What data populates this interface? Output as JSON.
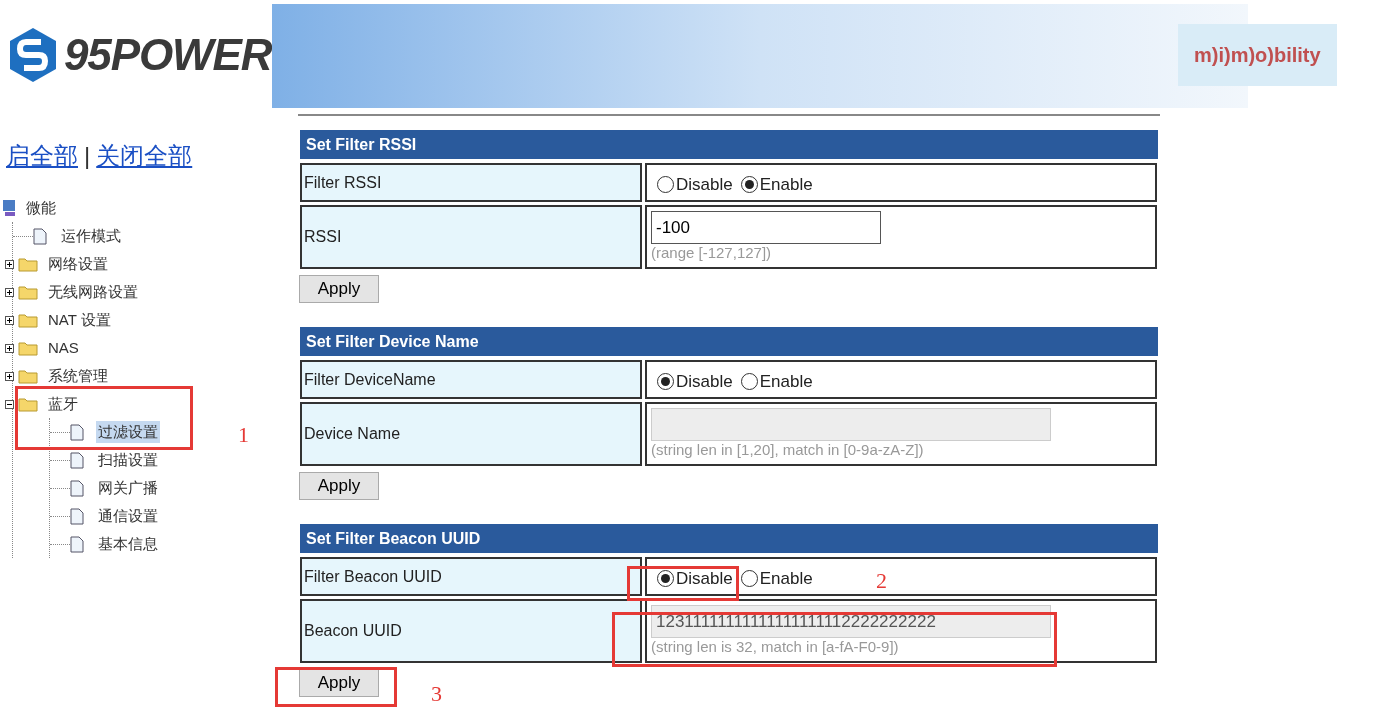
{
  "logo": {
    "text": "95POWER"
  },
  "partner_logo": {
    "text": "m)i)m)o)bility"
  },
  "sidebar": {
    "expand_all": "启全部",
    "separator": "|",
    "collapse_all": "关闭全部",
    "tree": {
      "label": "微能",
      "children": [
        {
          "label": "运作模式",
          "kind": "page",
          "selected": false
        },
        {
          "label": "网络设置",
          "kind": "folder",
          "expanded": false
        },
        {
          "label": "无线网路设置",
          "kind": "folder",
          "expanded": false
        },
        {
          "label": "NAT 设置",
          "kind": "folder",
          "expanded": false
        },
        {
          "label": "NAS",
          "kind": "folder",
          "expanded": false
        },
        {
          "label": "系统管理",
          "kind": "folder",
          "expanded": false
        },
        {
          "label": "蓝牙",
          "kind": "folder",
          "expanded": true,
          "children": [
            {
              "label": "过滤设置",
              "kind": "page",
              "selected": true
            },
            {
              "label": "扫描设置",
              "kind": "page",
              "selected": false
            },
            {
              "label": "网关广播",
              "kind": "page",
              "selected": false
            },
            {
              "label": "通信设置",
              "kind": "page",
              "selected": false
            },
            {
              "label": "基本信息",
              "kind": "page",
              "selected": false
            }
          ]
        }
      ]
    }
  },
  "sections": [
    {
      "title": "Set Filter RSSI",
      "rows": [
        {
          "label": "Filter RSSI",
          "kind": "radio",
          "options": [
            {
              "label": "Disable",
              "selected": false
            },
            {
              "label": "Enable",
              "selected": true
            }
          ]
        },
        {
          "label": "RSSI",
          "kind": "text",
          "value": "-100",
          "disabled": false,
          "hint": "(range [-127,127])"
        }
      ],
      "button": "Apply"
    },
    {
      "title": "Set Filter Device Name",
      "rows": [
        {
          "label": "Filter DeviceName",
          "kind": "radio",
          "options": [
            {
              "label": "Disable",
              "selected": true
            },
            {
              "label": "Enable",
              "selected": false
            }
          ]
        },
        {
          "label": "Device Name",
          "kind": "text",
          "disabled": true,
          "hint": "(string len in [1,20], match in [0-9a-zA-Z])"
        }
      ],
      "button": "Apply"
    },
    {
      "title": "Set Filter Beacon UUID",
      "rows": [
        {
          "label": "Filter Beacon UUID",
          "kind": "radio",
          "options": [
            {
              "label": "Disable",
              "selected": true
            },
            {
              "label": "Enable",
              "selected": false
            }
          ]
        },
        {
          "label": "Beacon UUID",
          "kind": "text",
          "value": "12311111111111111111112222222222",
          "disabled": true,
          "hint": "(string len is 32, match in [a-fA-F0-9])"
        }
      ],
      "button": "Apply"
    }
  ],
  "annotations": [
    {
      "number": "1"
    },
    {
      "number": "2"
    },
    {
      "number": "3"
    }
  ]
}
